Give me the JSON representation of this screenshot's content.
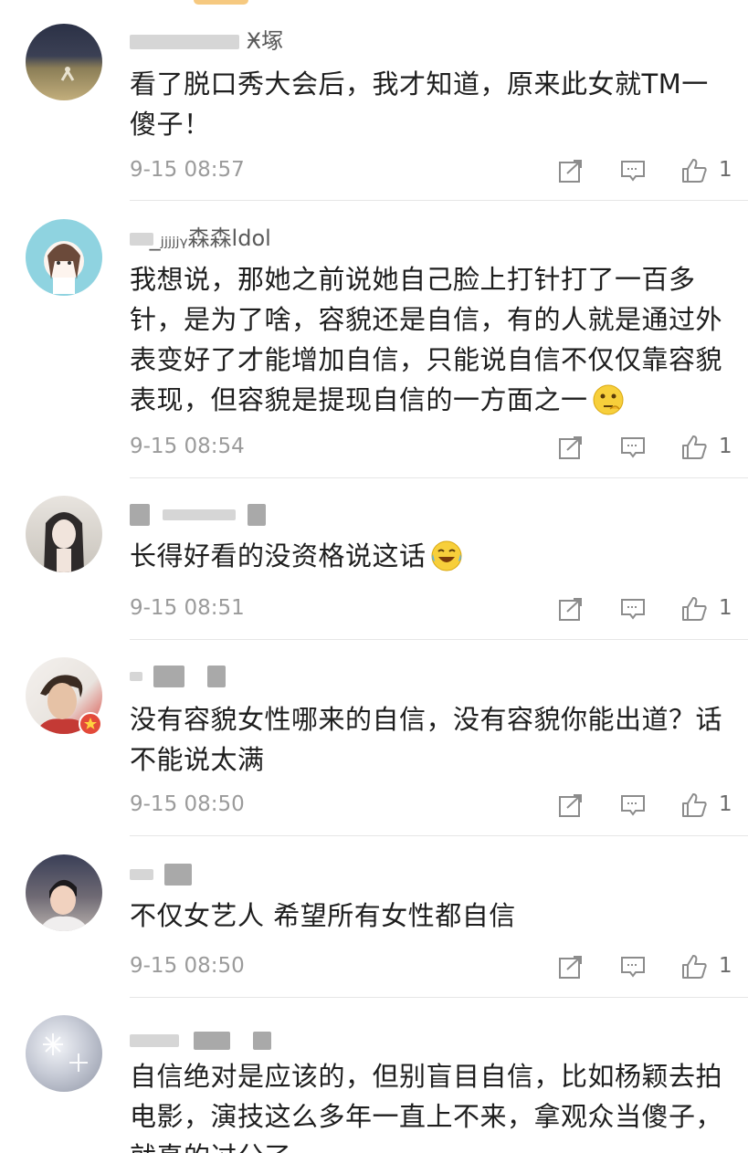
{
  "comments": [
    {
      "username": "Ӿ塚",
      "text": "看了脱口秀大会后，我才知道，原来此女就TM一傻子！",
      "time": "9-15 08:57",
      "likes": "1"
    },
    {
      "username": "̲ⱼⱼⱼⱼⱼᵧ森森ldol",
      "text": "我想说，那她之前说她自己脸上打针打了一百多针，是为了啥，容貌还是自信，有的人就是通过外表变好了才能增加自信，只能说自信不仅仅靠容貌表现，但容貌是提现自信的一方面之一",
      "time": "9-15 08:54",
      "likes": "1"
    },
    {
      "username": "",
      "text": "长得好看的没资格说这话",
      "time": "9-15 08:51",
      "likes": "1"
    },
    {
      "username": "",
      "text": "没有容貌女性哪来的自信，没有容貌你能出道？话不能说太满",
      "time": "9-15 08:50",
      "likes": "1"
    },
    {
      "username": "",
      "text": "不仅女艺人 希望所有女性都自信",
      "time": "9-15 08:50",
      "likes": "1"
    },
    {
      "username": "",
      "text": "自信绝对是应该的，但别盲目自信，比如杨颖去拍电影，演技这么多年一直上不来，拿观众当傻子，就真的过分了",
      "time": "",
      "likes": ""
    }
  ],
  "icons": {
    "share": "share-icon",
    "reply": "reply-icon",
    "like": "like-icon",
    "emoji_thinking": "thinking-emoji-icon",
    "emoji_laugh": "laugh-emoji-icon"
  },
  "colors": {
    "time": "#9b9b9b",
    "icon": "#8c8c8c",
    "text": "#1e1e1e",
    "divider": "#e6e6e6"
  }
}
